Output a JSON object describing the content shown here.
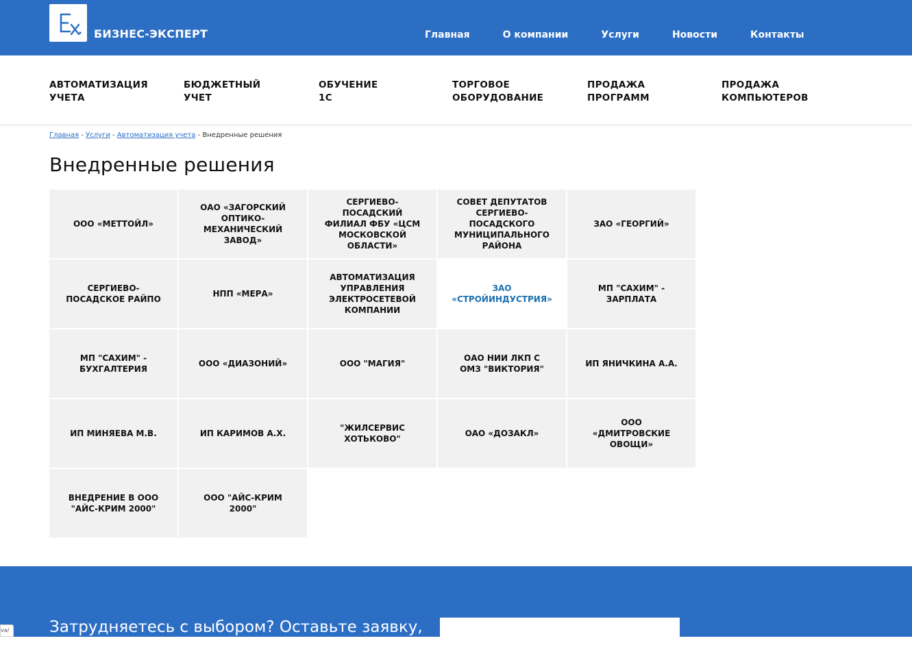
{
  "header": {
    "brand": "БИЗНЕС-ЭКСПЕРТ",
    "logo_text": "Ex",
    "nav": [
      "Главная",
      "О компании",
      "Услуги",
      "Новости",
      "Контакты"
    ]
  },
  "services": [
    {
      "line1": "Автоматизация",
      "line2": "учета"
    },
    {
      "line1": "Бюджетный",
      "line2": "учет"
    },
    {
      "line1": "Обучение",
      "line2": "1С"
    },
    {
      "line1": "Торговое",
      "line2": "оборудование"
    },
    {
      "line1": "Продажа",
      "line2": "программ"
    },
    {
      "line1": "Продажа",
      "line2": "компьютеров"
    }
  ],
  "breadcrumb": {
    "items": [
      "Главная",
      "Услуги",
      "Автоматизация учета"
    ],
    "separator": " - ",
    "current": "Внедренные решения"
  },
  "page_title": "Внедренные решения",
  "solutions": [
    "ООО «МЕТТОЙЛ»",
    "ОАО «ЗАГОРСКИЙ ОПТИКО-МЕХАНИЧЕСКИЙ ЗАВОД»",
    "СЕРГИЕВО-ПОСАДСКИЙ ФИЛИАЛ ФБУ «ЦСМ МОСКОВСКОЙ ОБЛАСТИ»",
    "СОВЕТ ДЕПУТАТОВ СЕРГИЕВО-ПОСАДСКОГО МУНИЦИПАЛЬНОГО РАЙОНА",
    "ЗАО «ГЕОРГИЙ»",
    "СЕРГИЕВО-ПОСАДСКОЕ РАЙПО",
    "НПП «МЕРА»",
    "АВТОМАТИЗАЦИЯ УПРАВЛЕНИЯ ЭЛЕКТРОСЕТЕВОЙ КОМПАНИИ",
    "ЗАО «СТРОЙИНДУСТРИЯ»",
    "МП \"САХИМ\" - ЗАРПЛАТА",
    "МП \"САХИМ\" - БУХГАЛТЕРИЯ",
    "ООО «ДИАЗОНИЙ»",
    "ООО \"МАГИЯ\"",
    "ОАО НИИ ЛКП С ОМЗ \"ВИКТОРИЯ\"",
    "ИП ЯНИЧКИНА А.А.",
    "ИП МИНЯЕВА М.В.",
    "ИП КАРИМОВ А.Х.",
    "\"ЖИЛСЕРВИС ХОТЬКОВО\"",
    "ОАО «ДОЗАКЛ»",
    "ООО «ДМИТРОВСКИЕ ОВОЩИ»",
    "ВНЕДРЕНИЕ В ООО \"АЙС-КРИМ 2000\"",
    "ООО \"АЙС-КРИМ 2000\""
  ],
  "active_solution_index": 8,
  "footer": {
    "text": "Затрудняетесь с выбором? Оставьте заявку,"
  },
  "corner_tag": "va/",
  "colors": {
    "brand_blue": "#2b6ec4",
    "cell_bg": "#f1f1f1",
    "active_text": "#1a6fb0"
  }
}
